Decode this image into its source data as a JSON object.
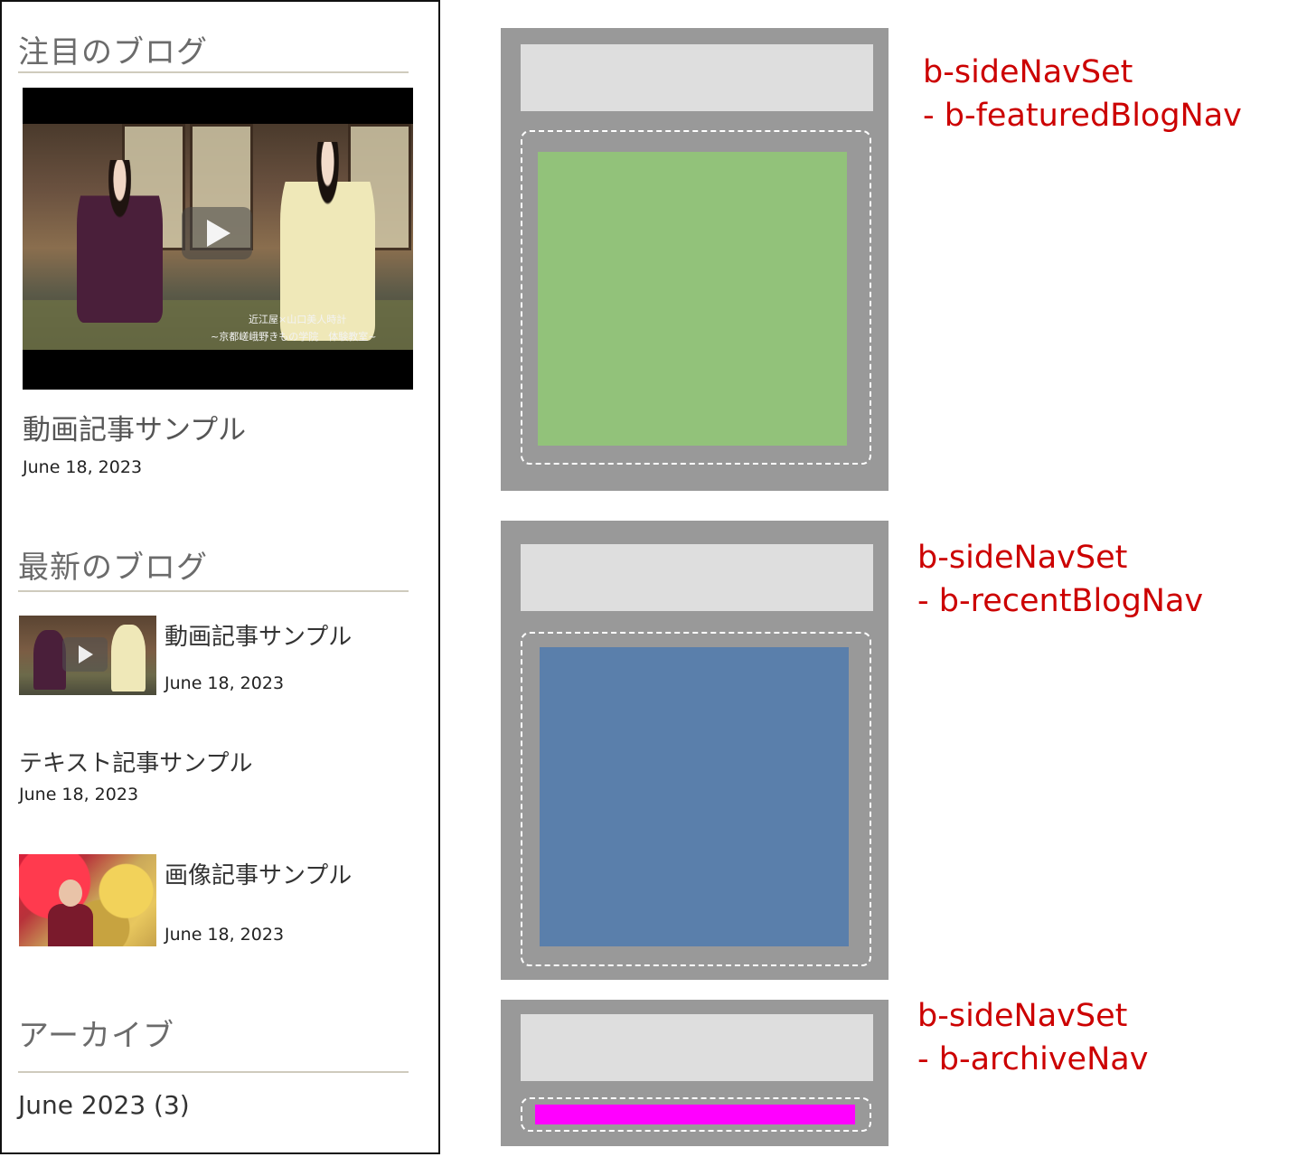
{
  "sidebar": {
    "featured": {
      "title": "注目のブログ",
      "video_caption_1": "近江屋×山口美人時計",
      "video_caption_2": "~京都嵯峨野きもの学院　体験教室~",
      "post_title": "動画記事サンプル",
      "post_date": "June 18, 2023"
    },
    "recent": {
      "title": "最新のブログ",
      "items": [
        {
          "title": "動画記事サンプル",
          "date": "June 18, 2023",
          "thumb": "video-thumbnail"
        },
        {
          "title": "テキスト記事サンプル",
          "date": "June 18, 2023",
          "thumb": "none"
        },
        {
          "title": "画像記事サンプル",
          "date": "June 18, 2023",
          "thumb": "image-thumbnail"
        }
      ]
    },
    "archive": {
      "title": "アーカイブ",
      "items": [
        "June 2023 (3)"
      ]
    }
  },
  "diagram": {
    "blocks": [
      {
        "label_line1": "b-sideNavSet",
        "label_line2": " - b-featuredBlogNav",
        "fill_color": "#92c27a"
      },
      {
        "label_line1": "b-sideNavSet",
        "label_line2": " - b-recentBlogNav",
        "fill_color": "#5a7fab"
      },
      {
        "label_line1": "b-sideNavSet",
        "label_line2": " - b-archiveNav",
        "fill_color": "#ff00ff"
      }
    ],
    "outer_color": "#999999",
    "header_color": "#dedede",
    "label_color": "#cc0000"
  }
}
